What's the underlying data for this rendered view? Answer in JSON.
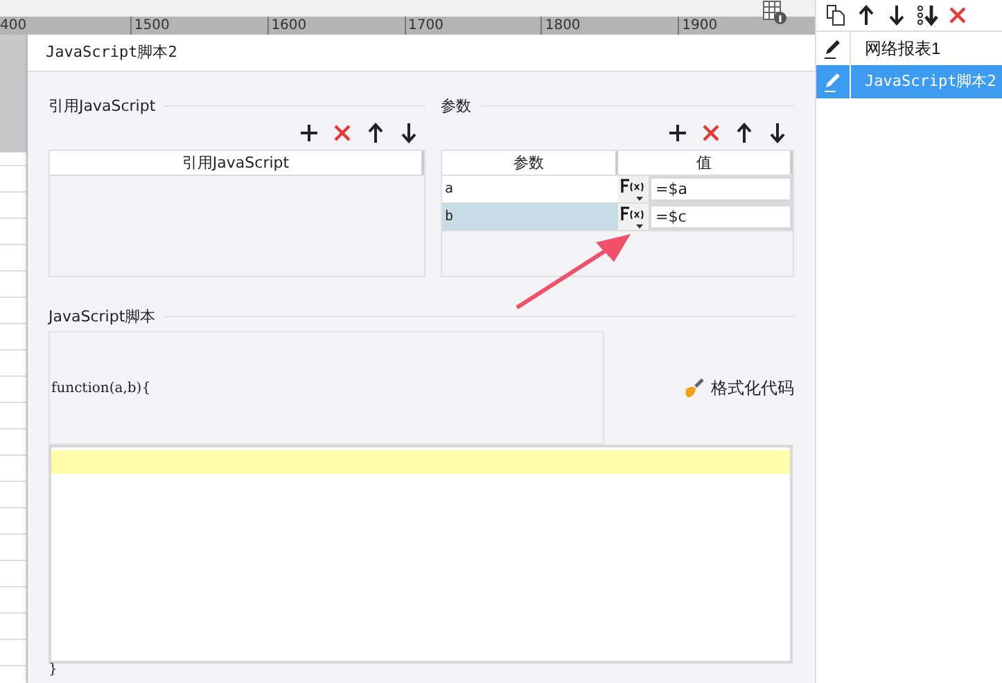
{
  "ruler": {
    "labels": [
      "400",
      "1500",
      "1600",
      "1700",
      "1800",
      "1900"
    ]
  },
  "dialog": {
    "title": "JavaScript脚本2",
    "refs": {
      "title": "引用JavaScript",
      "tools": [
        {
          "kind": "add"
        },
        {
          "kind": "delete"
        },
        {
          "kind": "up"
        },
        {
          "kind": "down"
        }
      ],
      "column": "引用JavaScript"
    },
    "params": {
      "title": "参数",
      "tools": [
        {
          "kind": "add"
        },
        {
          "kind": "delete"
        },
        {
          "kind": "up"
        },
        {
          "kind": "down"
        }
      ],
      "columns": [
        "参数",
        "值"
      ],
      "rows": [
        {
          "name": "a",
          "value": "=$a",
          "selected": false
        },
        {
          "name": "b",
          "value": "=$c",
          "selected": true
        }
      ]
    },
    "script": {
      "title": "JavaScript脚本",
      "header": "function(a,b){",
      "format_button": "格式化代码",
      "footer": "}"
    }
  },
  "sidebar": {
    "tools": [
      {
        "kind": "copy"
      },
      {
        "kind": "up"
      },
      {
        "kind": "down"
      },
      {
        "kind": "bottom"
      },
      {
        "kind": "delete"
      }
    ],
    "items": [
      {
        "label": "网络报表1",
        "selected": false
      },
      {
        "label": "JavaScript脚本2",
        "selected": true
      }
    ]
  }
}
